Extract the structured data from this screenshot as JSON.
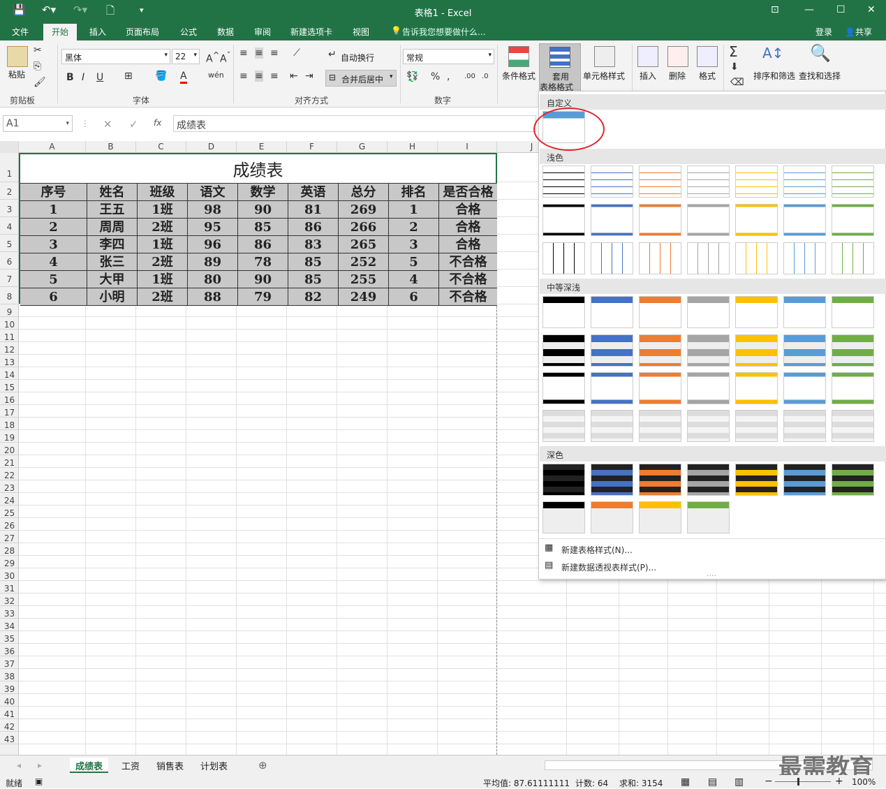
{
  "window": {
    "title": "表格1 - Excel",
    "share": "共享",
    "login": "登录"
  },
  "tabs": [
    "文件",
    "开始",
    "插入",
    "页面布局",
    "公式",
    "数据",
    "审阅",
    "新建选项卡",
    "视图"
  ],
  "tell_me": "告诉我您想要做什么...",
  "ribbon": {
    "paste": "粘贴",
    "clipboard": "剪贴板",
    "font_name": "黑体",
    "font_size": "22",
    "font_group": "字体",
    "wrap": "自动换行",
    "merge": "合并后居中",
    "align_group": "对齐方式",
    "number_format": "常规",
    "number_group": "数字",
    "cond_format": "条件格式",
    "table_format_1": "套用",
    "table_format_2": "表格格式",
    "cell_style": "单元格样式",
    "insert": "插入",
    "delete": "删除",
    "format": "格式",
    "sort": "排序和筛选",
    "find": "查找和选择"
  },
  "formula": {
    "cell_ref": "A1",
    "fx": "fx",
    "value": "成绩表"
  },
  "columns": [
    "A",
    "B",
    "C",
    "D",
    "E",
    "F",
    "G",
    "H",
    "I",
    "J"
  ],
  "rows": [
    "1",
    "2",
    "3",
    "4",
    "5",
    "6",
    "7",
    "8",
    "9",
    "10",
    "11",
    "12",
    "13",
    "14",
    "15",
    "16",
    "17",
    "18",
    "19",
    "20",
    "21",
    "22",
    "23",
    "24",
    "25",
    "26",
    "27",
    "28",
    "29",
    "30",
    "31",
    "32",
    "33",
    "34",
    "35",
    "36",
    "37",
    "38",
    "39",
    "40",
    "41",
    "42",
    "43"
  ],
  "table": {
    "title": "成绩表",
    "headers": [
      "序号",
      "姓名",
      "班级",
      "语文",
      "数学",
      "英语",
      "总分",
      "排名",
      "是否合格"
    ],
    "rows": [
      [
        "1",
        "王五",
        "1班",
        "98",
        "90",
        "81",
        "269",
        "1",
        "合格"
      ],
      [
        "2",
        "周周",
        "2班",
        "95",
        "85",
        "86",
        "266",
        "2",
        "合格"
      ],
      [
        "3",
        "李四",
        "1班",
        "96",
        "86",
        "83",
        "265",
        "3",
        "合格"
      ],
      [
        "4",
        "张三",
        "2班",
        "89",
        "78",
        "85",
        "252",
        "5",
        "不合格"
      ],
      [
        "5",
        "大甲",
        "1班",
        "80",
        "90",
        "85",
        "255",
        "4",
        "不合格"
      ],
      [
        "6",
        "小明",
        "2班",
        "88",
        "79",
        "82",
        "249",
        "6",
        "不合格"
      ]
    ]
  },
  "dropdown": {
    "custom": "自定义",
    "light": "浅色",
    "medium": "中等深浅",
    "dark": "深色",
    "new_table_style": "新建表格样式(N)...",
    "new_pivot_style": "新建数据透视表样式(P)...",
    "palette": [
      "#000000",
      "#4472c4",
      "#ed7d31",
      "#a5a5a5",
      "#ffc000",
      "#5b9bd5",
      "#70ad47"
    ],
    "highlight_color": "#e0242b"
  },
  "sheets": [
    "成绩表",
    "工资",
    "销售表",
    "计划表"
  ],
  "status": {
    "ready": "就绪",
    "avg": "平均值: 87.61111111",
    "count": "计数: 64",
    "sum": "求和: 3154",
    "zoom": "100%"
  },
  "watermark": "最需教育"
}
